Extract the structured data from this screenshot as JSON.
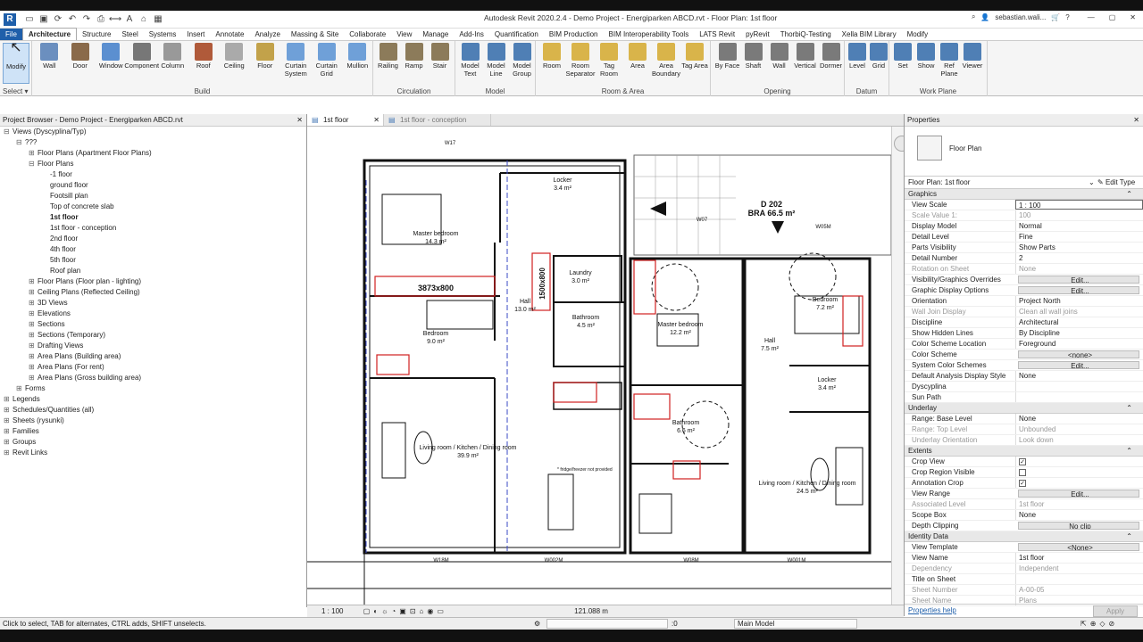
{
  "window": {
    "title": "Autodesk Revit 2020.2.4 - Demo Project - Energiparken ABCD.rvt - Floor Plan: 1st floor",
    "user": "sebastian.wali..."
  },
  "tabs": [
    "File",
    "Architecture",
    "Structure",
    "Steel",
    "Systems",
    "Insert",
    "Annotate",
    "Analyze",
    "Massing & Site",
    "Collaborate",
    "View",
    "Manage",
    "Add-Ins",
    "Quantification",
    "BIM Production",
    "BIM Interoperability Tools",
    "LATS Revit",
    "pyRevit",
    "ThorbiQ-Testing",
    "Xella BIM Library",
    "Modify"
  ],
  "ribbon": {
    "select": {
      "modify": "Modify",
      "label": "Select"
    },
    "build": {
      "label": "Build",
      "items": [
        "Wall",
        "Door",
        "Window",
        "Component",
        "Column",
        "Roof",
        "Ceiling",
        "Floor",
        "Curtain System",
        "Curtain Grid",
        "Mullion"
      ]
    },
    "circulation": {
      "label": "Circulation",
      "items": [
        "Railing",
        "Ramp",
        "Stair"
      ]
    },
    "model": {
      "label": "Model",
      "items": [
        "Model Text",
        "Model Line",
        "Model Group"
      ]
    },
    "room": {
      "label": "Room & Area",
      "items": [
        "Room",
        "Room Separator",
        "Tag Room",
        "Area",
        "Area Boundary",
        "Tag Area"
      ]
    },
    "opening": {
      "label": "Opening",
      "items": [
        "By Face",
        "Shaft",
        "Wall",
        "Vertical",
        "Dormer"
      ]
    },
    "datum": {
      "label": "Datum",
      "items": [
        "Level",
        "Grid"
      ]
    },
    "workplane": {
      "label": "Work Plane",
      "items": [
        "Set",
        "Show",
        "Ref Plane",
        "Viewer"
      ]
    }
  },
  "browser": {
    "title": "Project Browser - Demo Project - Energiparken ABCD.rvt",
    "tree": [
      {
        "t": "Views (Dyscyplina/Typ)",
        "lvl": 0,
        "exp": "-"
      },
      {
        "t": "???",
        "lvl": 1,
        "exp": "-"
      },
      {
        "t": "Floor Plans (Apartment Floor Plans)",
        "lvl": 2,
        "exp": "+"
      },
      {
        "t": "Floor Plans",
        "lvl": 2,
        "exp": "-"
      },
      {
        "t": "-1 floor",
        "lvl": 3
      },
      {
        "t": "ground floor",
        "lvl": 3
      },
      {
        "t": "Footsill plan",
        "lvl": 3
      },
      {
        "t": "Top of concrete slab",
        "lvl": 3
      },
      {
        "t": "1st floor",
        "lvl": 3,
        "sel": true
      },
      {
        "t": "1st floor - conception",
        "lvl": 3
      },
      {
        "t": "2nd floor",
        "lvl": 3
      },
      {
        "t": "4th floor",
        "lvl": 3
      },
      {
        "t": "5th floor",
        "lvl": 3
      },
      {
        "t": "Roof plan",
        "lvl": 3
      },
      {
        "t": "Floor Plans (Floor plan - lighting)",
        "lvl": 2,
        "exp": "+"
      },
      {
        "t": "Ceiling Plans (Reflected Ceiling)",
        "lvl": 2,
        "exp": "+"
      },
      {
        "t": "3D Views",
        "lvl": 2,
        "exp": "+"
      },
      {
        "t": "Elevations",
        "lvl": 2,
        "exp": "+"
      },
      {
        "t": "Sections",
        "lvl": 2,
        "exp": "+"
      },
      {
        "t": "Sections (Temporary)",
        "lvl": 2,
        "exp": "+"
      },
      {
        "t": "Drafting Views",
        "lvl": 2,
        "exp": "+"
      },
      {
        "t": "Area Plans (Building area)",
        "lvl": 2,
        "exp": "+"
      },
      {
        "t": "Area Plans (For rent)",
        "lvl": 2,
        "exp": "+"
      },
      {
        "t": "Area Plans (Gross building area)",
        "lvl": 2,
        "exp": "+"
      },
      {
        "t": "Forms",
        "lvl": 1,
        "exp": "+"
      },
      {
        "t": "Legends",
        "lvl": 0,
        "exp": "+"
      },
      {
        "t": "Schedules/Quantities (all)",
        "lvl": 0,
        "exp": "+"
      },
      {
        "t": "Sheets (rysunki)",
        "lvl": 0,
        "exp": "+"
      },
      {
        "t": "Families",
        "lvl": 0,
        "exp": "+"
      },
      {
        "t": "Groups",
        "lvl": 0,
        "exp": "+"
      },
      {
        "t": "Revit Links",
        "lvl": 0,
        "exp": "+"
      }
    ]
  },
  "viewtabs": [
    {
      "label": "1st floor",
      "active": true
    },
    {
      "label": "1st floor - conception",
      "active": false
    }
  ],
  "plan": {
    "rooms": [
      {
        "name": "Locker",
        "area": "3.4 m²"
      },
      {
        "name": "Master bedroom",
        "area": "14.3 m²"
      },
      {
        "name": "Laundry",
        "area": "3.0 m²"
      },
      {
        "name": "Hall",
        "area": "13.0 m²"
      },
      {
        "name": "Bathroom",
        "area": "4.5 m²"
      },
      {
        "name": "Bedroom",
        "area": "9.0 m²"
      },
      {
        "name": "Living room / Kitchen / Dining room",
        "area": "39.9 m²"
      },
      {
        "name": "Master bedroom",
        "area": "12.2 m²"
      },
      {
        "name": "Hall",
        "area": "7.5 m²"
      },
      {
        "name": "Bedroom",
        "area": "7.2 m²"
      },
      {
        "name": "Locker",
        "area": "3.4 m²"
      },
      {
        "name": "Bathroom",
        "area": "6.6 m²"
      },
      {
        "name": "Living room / Kitchen / Dining room",
        "area": "24.5 m²"
      }
    ],
    "balcony": {
      "code": "D 202",
      "bra": "BRA 66.5 m²"
    },
    "red_dims": [
      "3873x800",
      "1500x800"
    ],
    "windows": [
      "W17",
      "W07",
      "W05M",
      "W18M",
      "W002M",
      "W08M",
      "W001M"
    ],
    "note": "* fridge/freezer not provided",
    "scale": "1 : 100",
    "dim_bottom": "121.088 m"
  },
  "properties": {
    "title": "Properties",
    "type": "Floor Plan",
    "selector": "Floor Plan: 1st floor",
    "edit_type": "Edit Type",
    "sections": [
      {
        "name": "Graphics",
        "rows": [
          [
            "View Scale",
            "1 : 100",
            "input"
          ],
          [
            "Scale Value    1:",
            "100",
            "dis"
          ],
          [
            "Display Model",
            "Normal",
            ""
          ],
          [
            "Detail Level",
            "Fine",
            ""
          ],
          [
            "Parts Visibility",
            "Show Parts",
            ""
          ],
          [
            "Detail Number",
            "2",
            ""
          ],
          [
            "Rotation on Sheet",
            "None",
            "dis"
          ],
          [
            "Visibility/Graphics Overrides",
            "Edit...",
            "btn"
          ],
          [
            "Graphic Display Options",
            "Edit...",
            "btn"
          ],
          [
            "Orientation",
            "Project North",
            ""
          ],
          [
            "Wall Join Display",
            "Clean all wall joins",
            "dis"
          ],
          [
            "Discipline",
            "Architectural",
            ""
          ],
          [
            "Show Hidden Lines",
            "By Discipline",
            ""
          ],
          [
            "Color Scheme Location",
            "Foreground",
            ""
          ],
          [
            "Color Scheme",
            "<none>",
            "btn"
          ],
          [
            "System Color Schemes",
            "Edit...",
            "btn"
          ],
          [
            "Default Analysis Display Style",
            "None",
            ""
          ],
          [
            "Dyscyplina",
            "",
            ""
          ],
          [
            "Sun Path",
            "",
            ""
          ]
        ]
      },
      {
        "name": "Underlay",
        "rows": [
          [
            "Range: Base Level",
            "None",
            ""
          ],
          [
            "Range: Top Level",
            "Unbounded",
            "dis"
          ],
          [
            "Underlay Orientation",
            "Look down",
            "dis"
          ]
        ]
      },
      {
        "name": "Extents",
        "rows": [
          [
            "Crop View",
            "✓",
            "cb"
          ],
          [
            "Crop Region Visible",
            "",
            "cb"
          ],
          [
            "Annotation Crop",
            "✓",
            "cb"
          ],
          [
            "View Range",
            "Edit...",
            "btn"
          ],
          [
            "Associated Level",
            "1st floor",
            "dis"
          ],
          [
            "Scope Box",
            "None",
            ""
          ],
          [
            "Depth Clipping",
            "No clip",
            "btn"
          ]
        ]
      },
      {
        "name": "Identity Data",
        "rows": [
          [
            "View Template",
            "<None>",
            "btn"
          ],
          [
            "View Name",
            "1st floor",
            ""
          ],
          [
            "Dependency",
            "Independent",
            "dis"
          ],
          [
            "Title on Sheet",
            "",
            ""
          ],
          [
            "Sheet Number",
            "A-00-05",
            "dis"
          ],
          [
            "Sheet Name",
            "Plans",
            "dis"
          ]
        ]
      }
    ],
    "help": "Properties help",
    "apply": "Apply"
  },
  "statusbar": {
    "text": "Click to select, TAB for alternates, CTRL adds, SHIFT unselects.",
    "model": "Main Model",
    "zero": ":0"
  }
}
